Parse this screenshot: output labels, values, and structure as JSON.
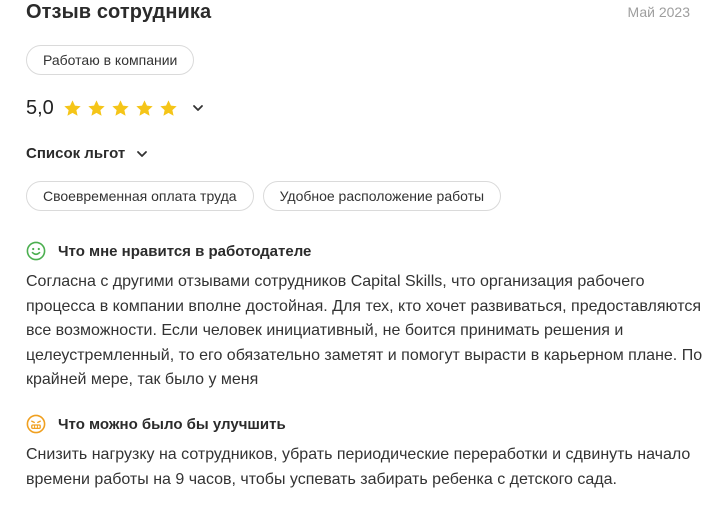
{
  "review": {
    "title": "Отзыв сотрудника",
    "date": "Май 2023",
    "status": "Работаю в компании",
    "rating": {
      "value_text": "5,0",
      "value": 5,
      "max": 5,
      "star_color": "#f5c518"
    },
    "benefits": {
      "header": "Список льгот",
      "items": [
        "Своевременная оплата труда",
        "Удобное расположение работы"
      ]
    },
    "likes": {
      "icon": "smile-face-icon",
      "icon_color": "#4caf50",
      "header": "Что мне нравится в работодателе",
      "text": "Согласна с другими отзывами сотрудников Capital Skills, что организация рабочего процесса в компании вполне достойная. Для тех, кто хочет развиваться, предоставляются все возможности. Если человек инициативный, не боится принимать решения и целеустремленный, то его обязательно заметят и помогут вырасти в карьерном плане. По крайней мере, так было у меня"
    },
    "improve": {
      "icon": "grimace-face-icon",
      "icon_color": "#f0a020",
      "header": "Что можно было бы улучшить",
      "text": "Снизить нагрузку на сотрудников, убрать периодические переработки и сдвинуть начало времени работы на 9 часов, чтобы успевать забирать ребенка с детского сада."
    }
  }
}
